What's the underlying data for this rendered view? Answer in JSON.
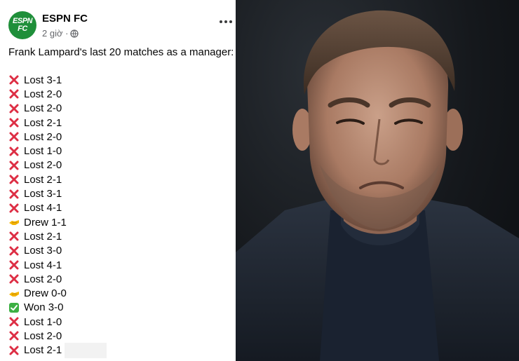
{
  "post": {
    "avatar_line1": "ESPN",
    "avatar_line2": "FC",
    "page_name": "ESPN FC",
    "time": "2 giờ ·",
    "intro": "Frank Lampard's last 20 matches as a manager:",
    "results": [
      {
        "icon": "cross-mark-icon",
        "text": "Lost 3-1"
      },
      {
        "icon": "cross-mark-icon",
        "text": "Lost 2-0"
      },
      {
        "icon": "cross-mark-icon",
        "text": "Lost 2-0"
      },
      {
        "icon": "cross-mark-icon",
        "text": "Lost 2-1"
      },
      {
        "icon": "cross-mark-icon",
        "text": "Lost 2-0"
      },
      {
        "icon": "cross-mark-icon",
        "text": "Lost 1-0"
      },
      {
        "icon": "cross-mark-icon",
        "text": "Lost 2-0"
      },
      {
        "icon": "cross-mark-icon",
        "text": "Lost 2-1"
      },
      {
        "icon": "cross-mark-icon",
        "text": "Lost 3-1"
      },
      {
        "icon": "cross-mark-icon",
        "text": "Lost 4-1"
      },
      {
        "icon": "handshake-icon",
        "text": "Drew 1-1"
      },
      {
        "icon": "cross-mark-icon",
        "text": "Lost 2-1"
      },
      {
        "icon": "cross-mark-icon",
        "text": "Lost 3-0"
      },
      {
        "icon": "cross-mark-icon",
        "text": "Lost 4-1"
      },
      {
        "icon": "cross-mark-icon",
        "text": "Lost 2-0"
      },
      {
        "icon": "handshake-icon",
        "text": "Drew 0-0"
      },
      {
        "icon": "check-mark-icon",
        "text": "Won 3-0"
      },
      {
        "icon": "cross-mark-icon",
        "text": "Lost 1-0"
      },
      {
        "icon": "cross-mark-icon",
        "text": "Lost 2-0"
      },
      {
        "icon": "cross-mark-icon",
        "text": "Lost 2-1"
      }
    ]
  },
  "colors": {
    "avatar_green": "#1f8f3a",
    "cross_red": "#dd2e44",
    "check_green": "#3cb043",
    "meta_gray": "#65676b"
  }
}
